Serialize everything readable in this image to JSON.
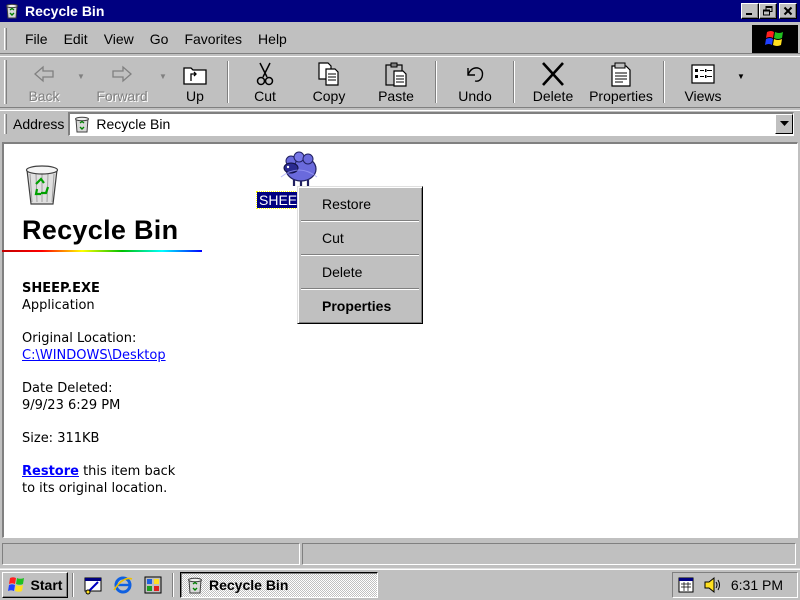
{
  "window": {
    "title": "Recycle Bin"
  },
  "menu": {
    "items": [
      {
        "label": "File"
      },
      {
        "label": "Edit"
      },
      {
        "label": "View"
      },
      {
        "label": "Go"
      },
      {
        "label": "Favorites"
      },
      {
        "label": "Help"
      }
    ]
  },
  "toolbar": {
    "back": "Back",
    "forward": "Forward",
    "up": "Up",
    "cut": "Cut",
    "copy": "Copy",
    "paste": "Paste",
    "undo": "Undo",
    "delete": "Delete",
    "properties": "Properties",
    "views": "Views"
  },
  "address": {
    "label": "Address",
    "value": "Recycle Bin"
  },
  "infopane": {
    "title": "Recycle Bin",
    "file_name": "SHEEP.EXE",
    "file_type": "Application",
    "original_location_label": "Original Location:",
    "original_location": "C:\\WINDOWS\\Desktop",
    "date_deleted_label": "Date Deleted:",
    "date_deleted": "9/9/23 6:29 PM",
    "size": "Size: 311KB",
    "restore_link": "Restore",
    "restore_text_1": " this item back",
    "restore_text_2": "to its original location."
  },
  "file_item": {
    "label": "SHEE"
  },
  "context_menu": {
    "restore": "Restore",
    "cut": "Cut",
    "delete": "Delete",
    "properties": "Properties"
  },
  "taskbar": {
    "start": "Start",
    "task_button": "Recycle Bin",
    "clock": "6:31 PM"
  },
  "colors": {
    "titlebar": "#000080",
    "face": "#c0c0c0",
    "link": "#0000ff",
    "selection": "#000080"
  }
}
